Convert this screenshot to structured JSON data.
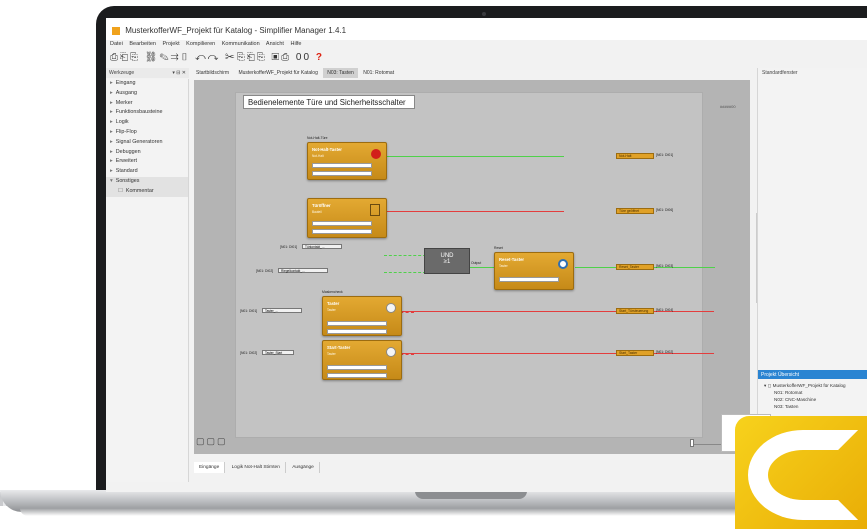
{
  "app": {
    "title": "MusterkofferWF_Projekt für Katalog - Simplifier Manager 1.4.1"
  },
  "menu": [
    "Datei",
    "Bearbeiten",
    "Projekt",
    "Kompilieren",
    "Kommunikation",
    "Ansicht",
    "Hilfe"
  ],
  "toolbar": {
    "icons": "⎙⎗⎘ ⛓✎⇉▯ ↶↷ ✂⎘⎗⎘ ▣⎙ 00",
    "warn": "?"
  },
  "left_panel": {
    "title": "Werkzeuge",
    "pin": "▾ ⊟ ✕",
    "items": [
      {
        "arrow": "▸",
        "label": "Eingang"
      },
      {
        "arrow": "▸",
        "label": "Ausgang"
      },
      {
        "arrow": "▸",
        "label": "Merker"
      },
      {
        "arrow": "▸",
        "label": "Funktionsbausteine"
      },
      {
        "arrow": "▸",
        "label": "Logik"
      },
      {
        "arrow": "▸",
        "label": "Flip-Flop"
      },
      {
        "arrow": "▸",
        "label": "Signal Generatoren"
      },
      {
        "arrow": "▸",
        "label": "Debuggen"
      },
      {
        "arrow": "▸",
        "label": "Erweitert"
      },
      {
        "arrow": "▸",
        "label": "Standard"
      },
      {
        "arrow": "▾",
        "label": "Sonstiges"
      }
    ],
    "child": {
      "icon": "☐",
      "label": "Kommentar"
    }
  },
  "doc_tabs": [
    "Startbildschirm",
    "MusterkofferWF_Projekt für Katalog",
    "N03: Tasten",
    "N01: Rotomat"
  ],
  "canvas": {
    "heading": "Bedienelemente Türe und Sicherheitsschalter",
    "scale": "#####00",
    "buttons": "▢▢▢",
    "and_label": "UND",
    "and_sym": "≥1",
    "and_out": "Output"
  },
  "blocks": [
    {
      "title": "Not-Halt-Taster",
      "sub": "Not-Halt",
      "group": "Not-Halt-Türe"
    },
    {
      "title": "Türöffner",
      "sub": "Bauteil"
    },
    {
      "title": "Taster",
      "sub": "Taster",
      "group": "Maskencheck"
    },
    {
      "title": "Start-Taster",
      "sub": "Taster"
    },
    {
      "title": "Reset-Taster",
      "sub": "Taster",
      "group": "Reset"
    }
  ],
  "outputs": [
    {
      "tag": "Not-Halt",
      "addr": "[N01: DI01]"
    },
    {
      "tag": "Türe geöffnet",
      "addr": "[N01: DI06]"
    },
    {
      "tag": "Reset_Taster",
      "addr": "[N01: DI03]"
    },
    {
      "tag": "Start_Türsteuerung",
      "addr": "[N01: DI04]"
    },
    {
      "tag": "Start_Taster",
      "addr": "[N01: DI02]"
    }
  ],
  "inputs": [
    {
      "addr": "[N01: DI01]",
      "tag": "Türkontakt_..."
    },
    {
      "addr": "[N01: DI02]",
      "tag": "Riegelkontakt_..."
    },
    {
      "addr": "[N01: DI01]",
      "tag": "Taster_..."
    },
    {
      "addr": "[N01: DI02]",
      "tag": "Taster_Start"
    }
  ],
  "sheet_tabs": [
    "Eingänge",
    "Logik Not-Halt Stirnten",
    "Ausgänge"
  ],
  "right_panel": {
    "title": "Standardfenster",
    "overview_title": "Projekt Übersicht",
    "tree": [
      "▾ ◻ MusterkofferWF_Projekt für Katalog",
      "N01: Rotomat",
      "N02: CNC-Maschine",
      "N03: Tasten"
    ]
  }
}
